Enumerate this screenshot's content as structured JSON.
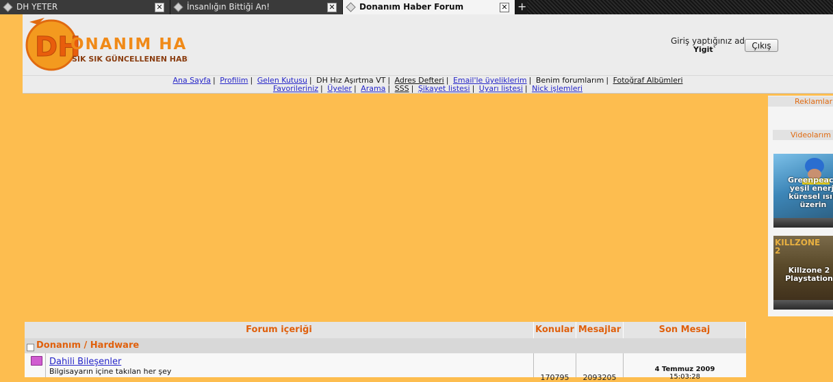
{
  "browser": {
    "tabs": [
      {
        "label": "DH YETER",
        "active": false
      },
      {
        "label": "İnsanlığın Bittiği An!",
        "active": false
      },
      {
        "label": "Donanım Haber Forum",
        "active": true
      }
    ],
    "close_glyph": "✕",
    "new_tab_glyph": "+"
  },
  "header": {
    "logo_text": "ONANIM HABER",
    "logo_mark": "DH",
    "logo_tagline": "SIK SIK GÜNCELLENEN HABER SITESI",
    "login_label": "Giriş yaptığınız ad",
    "username": "Yigit`",
    "logout_button": "Çıkış"
  },
  "nav": {
    "row1": [
      {
        "label": "Ana Sayfa",
        "link": true
      },
      {
        "label": "Profilim",
        "link": true
      },
      {
        "label": "Gelen Kutusu",
        "link": true
      },
      {
        "label": "DH Hız Aşırtma VT",
        "link": false
      },
      {
        "label": "Adres Defteri",
        "link": false
      },
      {
        "label": "Email'le üyeliklerim",
        "link": true
      },
      {
        "label": "Benim forumlarım",
        "link": false
      },
      {
        "label": "Fotoğraf Albümleri",
        "link": false
      }
    ],
    "row2": [
      {
        "label": "Favorileriniz",
        "link": true
      },
      {
        "label": "Üyeler",
        "link": true
      },
      {
        "label": "Arama",
        "link": true
      },
      {
        "label": "SSS",
        "link": false
      },
      {
        "label": "Şikayet listesi",
        "link": true
      },
      {
        "label": "Uyarı listesi",
        "link": true
      },
      {
        "label": "Nick işlemleri",
        "link": true
      }
    ]
  },
  "sidebar": {
    "ads_title": "Reklamlar",
    "videos_title": "Videolarım",
    "videos": [
      {
        "caption": "Greenpeace\nyeşil enerji\nküresel ısın\nüzerin"
      },
      {
        "caption": "Killzone 2\nPlaystation"
      }
    ],
    "video_badge": "KILLZONE 2"
  },
  "forum": {
    "columns": [
      "Forum içeriği",
      "Konular",
      "Mesajlar",
      "Son Mesaj"
    ],
    "category": "Donanım / Hardware",
    "rows": [
      {
        "name": "Dahili Bileşenler",
        "description": "Bilgisayarın içine takılan her şey",
        "topics": "170795",
        "posts": "2093205",
        "last_date": "4 Temmuz 2009",
        "last_time": "15:03:28"
      }
    ]
  },
  "colors": {
    "page_bg": "#fdbd4f",
    "accent_orange": "#e0600c",
    "link_blue": "#2424c8"
  }
}
